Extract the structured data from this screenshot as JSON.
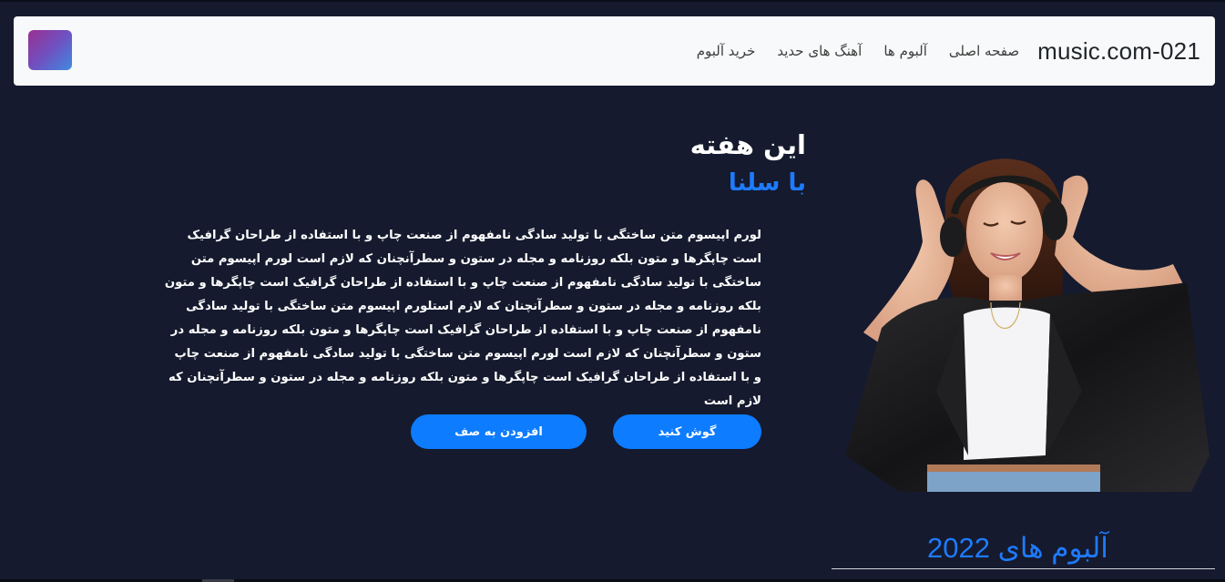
{
  "navbar": {
    "brand": "021-music.com",
    "links": [
      {
        "label": "صفحه اصلی"
      },
      {
        "label": "آلبوم ها"
      },
      {
        "label": "آهنگ های حدید"
      },
      {
        "label": "خرید آلبوم"
      }
    ]
  },
  "hero": {
    "title": "این هفته",
    "subtitle": "با سلنا",
    "description": "لورم اپیسوم متن ساختگی با تولید سادگی نامفهوم از صنعت چاپ و با استفاده از طراحان گرافیک است چاپگرها و متون بلکه روزنامه و مجله در ستون و سطرآنچنان که لازم است لورم اپیسوم متن ساختگی با تولید سادگی نامفهوم از صنعت چاپ و با استفاده از طراحان گرافیک است چاپگرها و متون بلکه روزنامه و مجله در ستون و سطرآنچنان که لازم استلورم اپیسوم متن ساختگی با تولید سادگی نامفهوم از صنعت چاپ و با استفاده از طراحان گرافیک است چاپگرها و متون بلکه روزنامه و مجله در ستون و سطرآنچنان که لازم است لورم اپیسوم متن ساختگی با تولید سادگی نامفهوم از صنعت چاپ و با استفاده از طراحان گرافیک است چاپگرها و متون بلکه روزنامه و مجله در ستون و سطرآنچنان که لازم است",
    "listen_button": "گوش کنید",
    "queue_button": "افزودن به صف"
  },
  "albums": {
    "title": "آلبوم های 2022"
  },
  "colors": {
    "background": "#151a2e",
    "accent": "#0d7cff",
    "navbar_bg": "#f8f9fa"
  }
}
